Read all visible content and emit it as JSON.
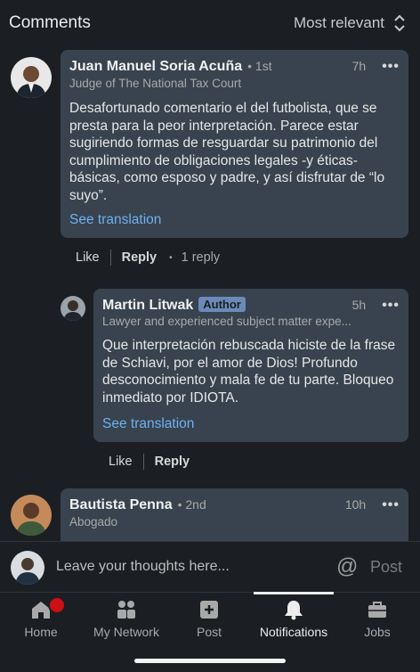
{
  "header": {
    "title": "Comments",
    "sort_label": "Most relevant"
  },
  "comments": [
    {
      "name": "Juan Manuel Soria Acuña",
      "degree": "• 1st",
      "time": "7h",
      "more": "•••",
      "headline": "Judge of The National Tax Court",
      "body": "Desafortunado comentario el del futbolista, que se presta para la peor interpretación. Parece estar sugiriendo formas de resguardar su patrimonio del cumplimiento de obligaciones legales -y éticas- básicas, como esposo y padre, y así disfrutar de “lo suyo”.",
      "see_translation": "See translation",
      "actions": {
        "like": "Like",
        "reply": "Reply",
        "dot": "•",
        "replies": "1 reply"
      }
    },
    {
      "name": "Martin Litwak",
      "badge": "Author",
      "time": "5h",
      "more": "•••",
      "headline": "Lawyer and experienced subject matter expe...",
      "body": "Que interpretación rebuscada hiciste de la frase de Schiavi, por el amor de Dios! Profundo desconocimiento y mala fe de tu parte. Bloqueo inmediato por IDIOTA.",
      "see_translation": "See translation",
      "actions": {
        "like": "Like",
        "reply": "Reply"
      }
    },
    {
      "name": "Bautista Penna",
      "degree": "• 2nd",
      "time": "10h",
      "more": "•••",
      "headline": "Abogado"
    }
  ],
  "composer": {
    "placeholder": "Leave your thoughts here...",
    "at_symbol": "@",
    "post_label": "Post"
  },
  "tabs": [
    {
      "label": "Home",
      "icon": "home-icon",
      "has_badge": true
    },
    {
      "label": "My Network",
      "icon": "network-icon"
    },
    {
      "label": "Post",
      "icon": "post-icon"
    },
    {
      "label": "Notifications",
      "icon": "bell-icon",
      "active": true
    },
    {
      "label": "Jobs",
      "icon": "briefcase-icon"
    }
  ],
  "colors": {
    "background": "#1b1f23",
    "bubble": "#38434f",
    "link": "#6fb0f0",
    "badge": "#cc1016",
    "author_badge": "#6a8bb8"
  }
}
